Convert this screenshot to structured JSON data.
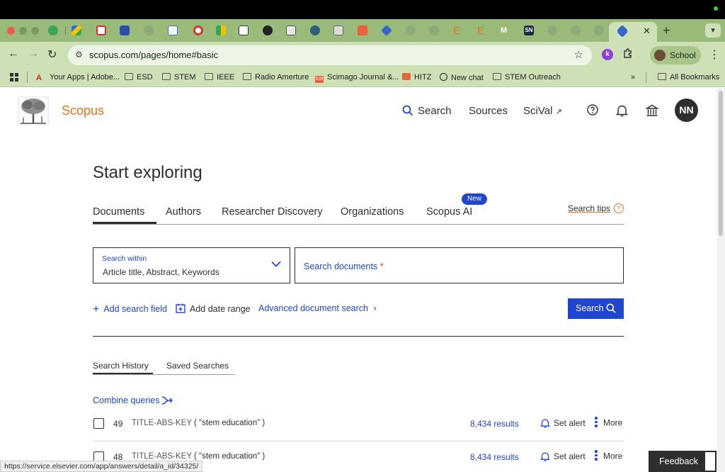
{
  "browser": {
    "url": "scopus.com/pages/home#basic",
    "profile_label": "School",
    "extension_letter": "k",
    "bookmarks": [
      {
        "label": "Your Apps | Adobe...",
        "icon": "adobe-icon"
      },
      {
        "label": "ESD",
        "icon": "folder-icon"
      },
      {
        "label": "STEM",
        "icon": "folder-icon"
      },
      {
        "label": "IEEE",
        "icon": "folder-icon"
      },
      {
        "label": "Radio Amerture",
        "icon": "folder-icon"
      },
      {
        "label": "Scimago Journal &...",
        "icon": "sjr-icon"
      },
      {
        "label": "HITZ",
        "icon": "hitz-icon"
      },
      {
        "label": "New chat",
        "icon": "openai-icon"
      },
      {
        "label": "STEM Outreach",
        "icon": "folder-icon"
      }
    ],
    "all_bookmarks_label": "All Bookmarks",
    "status_url": "https://service.elsevier.com/app/answers/detail/a_id/34325/"
  },
  "header": {
    "brand": "Scopus",
    "nav": {
      "search": "Search",
      "sources": "Sources",
      "scival": "SciVal"
    },
    "avatar_initials": "NN"
  },
  "main": {
    "title": "Start exploring",
    "tabs": [
      "Documents",
      "Authors",
      "Researcher Discovery",
      "Organizations",
      "Scopus AI"
    ],
    "new_badge": "New",
    "search_tips": "Search tips",
    "search_within_label": "Search within",
    "search_within_value": "Article title, Abstract, Keywords",
    "search_placeholder": "Search documents",
    "required_mark": "*",
    "add_field": "Add search field",
    "add_date": "Add date range",
    "advanced": "Advanced document search",
    "search_button": "Search"
  },
  "history": {
    "tabs": [
      "Search History",
      "Saved Searches"
    ],
    "combine": "Combine queries",
    "rows": [
      {
        "num": "49",
        "field": "TITLE-ABS-KEY",
        "query": "( \"stem education\" )",
        "results": "8,434 results",
        "alert": "Set alert",
        "more": "More"
      },
      {
        "num": "48",
        "field": "TITLE-ABS-KEY",
        "query": "( \"stem education\" )",
        "results": "8,434 results",
        "alert": "Set alert",
        "more": "More"
      }
    ]
  },
  "feedback": "Feedback",
  "colors": {
    "brand": "#e9711c",
    "link": "#1f45d1",
    "text": "#2e2e2e"
  }
}
